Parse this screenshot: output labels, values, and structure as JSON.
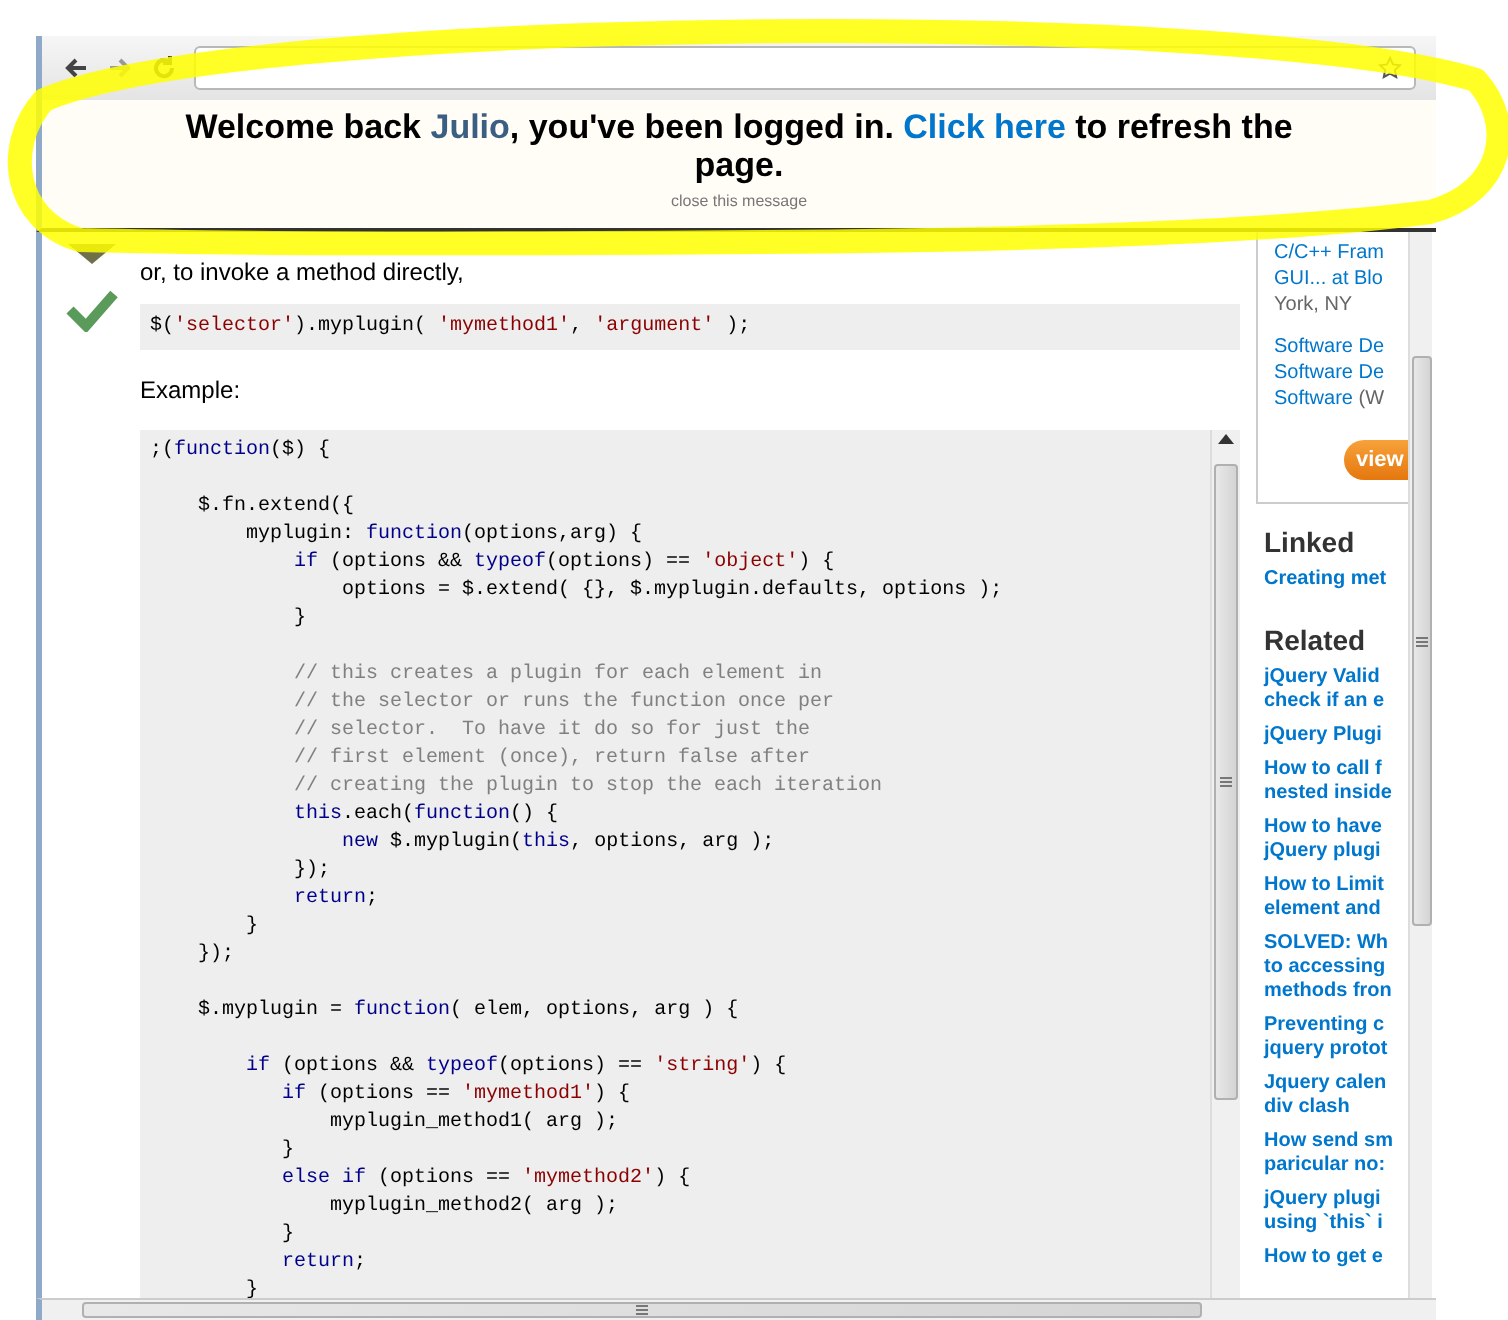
{
  "banner": {
    "message": [
      {
        "kind": "text",
        "t": "Welcome back "
      },
      {
        "kind": "user",
        "t": "Julio"
      },
      {
        "kind": "text",
        "t": ", you've been logged in. "
      },
      {
        "kind": "link",
        "t": "Click here"
      },
      {
        "kind": "text",
        "t": " to refresh the page."
      }
    ],
    "close": "close this message"
  },
  "answer": {
    "accepted": true,
    "intro": "or, to invoke a method directly,",
    "snippet": [
      {
        "kind": "p",
        "t": "$("
      },
      {
        "kind": "str",
        "t": "'selector'"
      },
      {
        "kind": "p",
        "t": ").myplugin( "
      },
      {
        "kind": "str",
        "t": "'mymethod1'"
      },
      {
        "kind": "p",
        "t": ", "
      },
      {
        "kind": "str",
        "t": "'argument'"
      },
      {
        "kind": "p",
        "t": " );"
      }
    ],
    "example_label": "Example:",
    "code": [
      {
        "kind": "code",
        "segments": [
          {
            "kind": "p",
            "t": ";("
          },
          {
            "kind": "kw",
            "t": "function"
          },
          {
            "kind": "p",
            "t": "($) {"
          }
        ]
      },
      {
        "kind": "blank"
      },
      {
        "kind": "code",
        "segments": [
          {
            "kind": "p",
            "t": "    $.fn.extend({"
          }
        ]
      },
      {
        "kind": "code",
        "segments": [
          {
            "kind": "p",
            "t": "        myplugin: "
          },
          {
            "kind": "kw",
            "t": "function"
          },
          {
            "kind": "p",
            "t": "(options,arg) {"
          }
        ]
      },
      {
        "kind": "code",
        "segments": [
          {
            "kind": "kw",
            "t": "            if"
          },
          {
            "kind": "p",
            "t": " (options && "
          },
          {
            "kind": "kw",
            "t": "typeof"
          },
          {
            "kind": "p",
            "t": "(options) == "
          },
          {
            "kind": "str",
            "t": "'object'"
          },
          {
            "kind": "p",
            "t": ") {"
          }
        ]
      },
      {
        "kind": "code",
        "segments": [
          {
            "kind": "p",
            "t": "                options = $.extend( {}, $.myplugin.defaults, options );"
          }
        ]
      },
      {
        "kind": "code",
        "segments": [
          {
            "kind": "p",
            "t": "            }"
          }
        ]
      },
      {
        "kind": "blank"
      },
      {
        "kind": "code",
        "segments": [
          {
            "kind": "com",
            "t": "            // this creates a plugin for each element in"
          }
        ]
      },
      {
        "kind": "code",
        "segments": [
          {
            "kind": "com",
            "t": "            // the selector or runs the function once per"
          }
        ]
      },
      {
        "kind": "code",
        "segments": [
          {
            "kind": "com",
            "t": "            // selector.  To have it do so for just the"
          }
        ]
      },
      {
        "kind": "code",
        "segments": [
          {
            "kind": "com",
            "t": "            // first element (once), return false after"
          }
        ]
      },
      {
        "kind": "code",
        "segments": [
          {
            "kind": "com",
            "t": "            // creating the plugin to stop the each iteration"
          }
        ]
      },
      {
        "kind": "code",
        "segments": [
          {
            "kind": "kw",
            "t": "            this"
          },
          {
            "kind": "p",
            "t": ".each("
          },
          {
            "kind": "kw",
            "t": "function"
          },
          {
            "kind": "p",
            "t": "() {"
          }
        ]
      },
      {
        "kind": "code",
        "segments": [
          {
            "kind": "kw",
            "t": "                new"
          },
          {
            "kind": "p",
            "t": " $.myplugin("
          },
          {
            "kind": "kw",
            "t": "this"
          },
          {
            "kind": "p",
            "t": ", options, arg );"
          }
        ]
      },
      {
        "kind": "code",
        "segments": [
          {
            "kind": "p",
            "t": "            });"
          }
        ]
      },
      {
        "kind": "code",
        "segments": [
          {
            "kind": "kw",
            "t": "            return"
          },
          {
            "kind": "p",
            "t": ";"
          }
        ]
      },
      {
        "kind": "code",
        "segments": [
          {
            "kind": "p",
            "t": "        }"
          }
        ]
      },
      {
        "kind": "code",
        "segments": [
          {
            "kind": "p",
            "t": "    });"
          }
        ]
      },
      {
        "kind": "blank"
      },
      {
        "kind": "code",
        "segments": [
          {
            "kind": "p",
            "t": "    $.myplugin = "
          },
          {
            "kind": "kw",
            "t": "function"
          },
          {
            "kind": "p",
            "t": "( elem, options, arg ) {"
          }
        ]
      },
      {
        "kind": "blank"
      },
      {
        "kind": "code",
        "segments": [
          {
            "kind": "kw",
            "t": "        if"
          },
          {
            "kind": "p",
            "t": " (options && "
          },
          {
            "kind": "kw",
            "t": "typeof"
          },
          {
            "kind": "p",
            "t": "(options) == "
          },
          {
            "kind": "str",
            "t": "'string'"
          },
          {
            "kind": "p",
            "t": ") {"
          }
        ]
      },
      {
        "kind": "code",
        "segments": [
          {
            "kind": "kw",
            "t": "           if"
          },
          {
            "kind": "p",
            "t": " (options == "
          },
          {
            "kind": "str",
            "t": "'mymethod1'"
          },
          {
            "kind": "p",
            "t": ") {"
          }
        ]
      },
      {
        "kind": "code",
        "segments": [
          {
            "kind": "p",
            "t": "               myplugin_method1( arg );"
          }
        ]
      },
      {
        "kind": "code",
        "segments": [
          {
            "kind": "p",
            "t": "           }"
          }
        ]
      },
      {
        "kind": "code",
        "segments": [
          {
            "kind": "kw",
            "t": "           else if"
          },
          {
            "kind": "p",
            "t": " (options == "
          },
          {
            "kind": "str",
            "t": "'mymethod2'"
          },
          {
            "kind": "p",
            "t": ") {"
          }
        ]
      },
      {
        "kind": "code",
        "segments": [
          {
            "kind": "p",
            "t": "               myplugin_method2( arg );"
          }
        ]
      },
      {
        "kind": "code",
        "segments": [
          {
            "kind": "p",
            "t": "           }"
          }
        ]
      },
      {
        "kind": "code",
        "segments": [
          {
            "kind": "kw",
            "t": "           return"
          },
          {
            "kind": "p",
            "t": ";"
          }
        ]
      },
      {
        "kind": "code",
        "segments": [
          {
            "kind": "p",
            "t": "        }"
          }
        ]
      }
    ]
  },
  "sidebar": {
    "jobs": [
      {
        "title_lines": [
          "C/C++ Fram",
          "GUI... at Blo"
        ],
        "location": "York, NY",
        "location_inline": false
      },
      {
        "title_lines": [
          "Software De",
          "Software De",
          "Software"
        ],
        "location": "(W",
        "location_inline": true
      }
    ],
    "jobs_button": "view",
    "linked_heading": "Linked",
    "linked": [
      {
        "lines": [
          "Creating met"
        ]
      }
    ],
    "related_heading": "Related",
    "related": [
      {
        "lines": [
          "jQuery Valid",
          "check if an e"
        ]
      },
      {
        "lines": [
          "jQuery Plugi"
        ]
      },
      {
        "lines": [
          "How to call f",
          "nested inside"
        ]
      },
      {
        "lines": [
          "How to have",
          "jQuery plugi"
        ]
      },
      {
        "lines": [
          "How to Limit",
          "element and"
        ]
      },
      {
        "lines": [
          "SOLVED: Wh",
          "to accessing",
          "methods fron"
        ]
      },
      {
        "lines": [
          "Preventing c",
          "jquery protot"
        ]
      },
      {
        "lines": [
          "Jquery calen",
          "div clash"
        ]
      },
      {
        "lines": [
          "How send sm",
          "paricular no:"
        ]
      },
      {
        "lines": [
          "jQuery plugi",
          "using `this` i"
        ]
      },
      {
        "lines": [
          "How to get e"
        ]
      }
    ]
  }
}
